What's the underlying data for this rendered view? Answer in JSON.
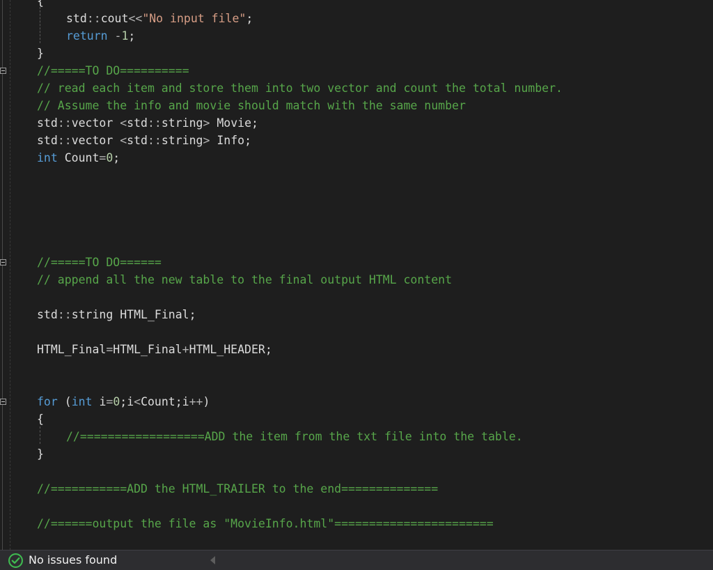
{
  "editor": {
    "lines": [
      [
        {
          "t": "{",
          "c": "pl"
        }
      ],
      [
        {
          "t": "std",
          "c": "pl"
        },
        {
          "t": "::",
          "c": "op"
        },
        {
          "t": "cout",
          "c": "pl"
        },
        {
          "t": "<<",
          "c": "op"
        },
        {
          "t": "\"No input file\"",
          "c": "str"
        },
        {
          "t": ";",
          "c": "pl"
        }
      ],
      [
        {
          "t": "return ",
          "c": "kw"
        },
        {
          "t": "-",
          "c": "op"
        },
        {
          "t": "1",
          "c": "num"
        },
        {
          "t": ";",
          "c": "pl"
        }
      ],
      [
        {
          "t": "}",
          "c": "pl"
        }
      ],
      [
        {
          "t": "//=====TO DO==========",
          "c": "cm"
        }
      ],
      [
        {
          "t": "// read each item and store them into two vector and count the total number.",
          "c": "cm"
        }
      ],
      [
        {
          "t": "// Assume the info and movie should match with the same number",
          "c": "cm"
        }
      ],
      [
        {
          "t": "std",
          "c": "pl"
        },
        {
          "t": "::",
          "c": "op"
        },
        {
          "t": "vector ",
          "c": "pl"
        },
        {
          "t": "<",
          "c": "op"
        },
        {
          "t": "std",
          "c": "pl"
        },
        {
          "t": "::",
          "c": "op"
        },
        {
          "t": "string",
          "c": "pl"
        },
        {
          "t": ">",
          "c": "op"
        },
        {
          "t": " Movie;",
          "c": "pl"
        }
      ],
      [
        {
          "t": "std",
          "c": "pl"
        },
        {
          "t": "::",
          "c": "op"
        },
        {
          "t": "vector ",
          "c": "pl"
        },
        {
          "t": "<",
          "c": "op"
        },
        {
          "t": "std",
          "c": "pl"
        },
        {
          "t": "::",
          "c": "op"
        },
        {
          "t": "string",
          "c": "pl"
        },
        {
          "t": ">",
          "c": "op"
        },
        {
          "t": " Info;",
          "c": "pl"
        }
      ],
      [
        {
          "t": "int ",
          "c": "kw"
        },
        {
          "t": "Count",
          "c": "pl"
        },
        {
          "t": "=",
          "c": "op"
        },
        {
          "t": "0",
          "c": "num"
        },
        {
          "t": ";",
          "c": "pl"
        }
      ],
      [],
      [],
      [],
      [],
      [],
      [
        {
          "t": "//=====TO DO======",
          "c": "cm"
        }
      ],
      [
        {
          "t": "// append all the new table to the final output HTML content",
          "c": "cm"
        }
      ],
      [],
      [
        {
          "t": "std",
          "c": "pl"
        },
        {
          "t": "::",
          "c": "op"
        },
        {
          "t": "string HTML_Final;",
          "c": "pl"
        }
      ],
      [],
      [
        {
          "t": "HTML_Final",
          "c": "pl"
        },
        {
          "t": "=",
          "c": "op"
        },
        {
          "t": "HTML_Final",
          "c": "pl"
        },
        {
          "t": "+",
          "c": "op"
        },
        {
          "t": "HTML_HEADER;",
          "c": "pl"
        }
      ],
      [],
      [],
      [
        {
          "t": "for ",
          "c": "kw"
        },
        {
          "t": "(",
          "c": "pl"
        },
        {
          "t": "int ",
          "c": "kw"
        },
        {
          "t": "i",
          "c": "pl"
        },
        {
          "t": "=",
          "c": "op"
        },
        {
          "t": "0",
          "c": "num"
        },
        {
          "t": ";",
          "c": "pl"
        },
        {
          "t": "i",
          "c": "pl"
        },
        {
          "t": "<",
          "c": "op"
        },
        {
          "t": "Count",
          "c": "pl"
        },
        {
          "t": ";",
          "c": "pl"
        },
        {
          "t": "i",
          "c": "pl"
        },
        {
          "t": "++",
          "c": "op"
        },
        {
          "t": ")",
          "c": "pl"
        }
      ],
      [
        {
          "t": "{",
          "c": "pl"
        }
      ],
      [
        {
          "t": "//==================ADD the item from the txt file into the table.",
          "c": "cm"
        }
      ],
      [
        {
          "t": "}",
          "c": "pl"
        }
      ],
      [],
      [
        {
          "t": "//===========ADD the HTML_TRAILER to the end==============",
          "c": "cm"
        }
      ],
      [],
      [
        {
          "t": "//======output the file as \"MovieInfo.html\"=======================",
          "c": "cm"
        }
      ]
    ]
  },
  "status_bar": {
    "icon": "check-circle-icon",
    "text": "No issues found",
    "accent_color": "#3fb950",
    "background_color": "#2d2d30"
  },
  "theme": {
    "background": "#1e1e1e",
    "keyword": "#569cd6",
    "comment": "#57a64a",
    "string": "#d69d85",
    "text": "#dcdcdc"
  }
}
